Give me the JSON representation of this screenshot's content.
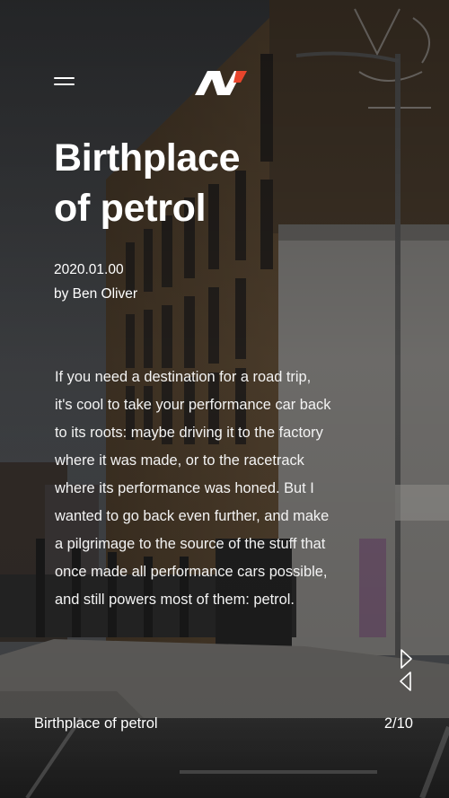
{
  "article": {
    "title_line1": "Birthplace",
    "title_line2": "of petrol",
    "date": "2020.01.00",
    "byline": "by Ben Oliver",
    "body_lines": [
      "If you need a destination for a road trip,",
      "it's cool to take your performance car back",
      "to its roots: maybe driving it to the factory",
      "where it was made, or to the racetrack",
      "where its performance was honed. But I",
      "wanted to go back even further, and make",
      "a pilgrimage to the source of the stuff that",
      "once made all performance cars possible,",
      "and still powers most of them: petrol."
    ]
  },
  "header": {
    "menu_icon": "hamburger-menu-icon",
    "logo_icon": "n-brand-logo",
    "logo_accent_color": "#e8452c"
  },
  "footer": {
    "title": "Birthplace of petrol",
    "page_indicator": "2/10",
    "next_icon": "chevron-right-outline-icon",
    "prev_icon": "chevron-left-outline-icon"
  }
}
